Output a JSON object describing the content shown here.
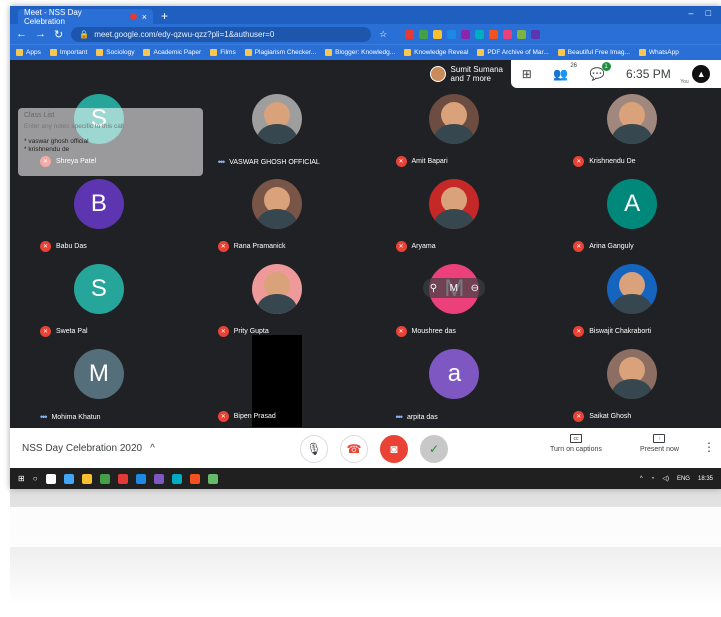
{
  "browser": {
    "tab_title": "Meet - NSS Day Celebration",
    "tab_close": "×",
    "new_tab": "+",
    "url": "meet.google.com/edy-qzwu-qzz?pli=1&authuser=0",
    "bookmarks": [
      "Apps",
      "Important",
      "Sociology",
      "Academic Paper",
      "Films",
      "Plagiarism Checker...",
      "Blogger: Knowledg...",
      "Knowledge Reveal",
      "PDF Archive of Mar...",
      "Beautiful Free Imag...",
      "WhatsApp"
    ],
    "extension_colors": [
      "#e53935",
      "#43a047",
      "#fbc02d",
      "#1e88e5",
      "#8e24aa",
      "#00acc1",
      "#f4511e",
      "#ec407a",
      "#7cb342",
      "#5e35b1"
    ]
  },
  "meet": {
    "presenter_chip": "Sumit Sumana",
    "presenter_chip_sub": "and 7 more",
    "chat_badge": "1",
    "people_count": "26",
    "clock": "6:35 PM",
    "you_label": "You",
    "meeting_title": "NSS Day Celebration 2020",
    "captions_label": "Turn on captions",
    "present_label": "Present now"
  },
  "class_list": {
    "title": "Class List",
    "note": "Enter any notes specific to this call",
    "entries": [
      "* vaswar ghosh official",
      "* krishnendu de"
    ]
  },
  "participants": [
    {
      "name": "Shreya Patel",
      "initial": "S",
      "color": "#26a69a",
      "type": "initial",
      "muted": true
    },
    {
      "name": "VASWAR GHOSH OFFICIAL",
      "initial": "",
      "color": "#9e9e9e",
      "type": "photo",
      "muted": false
    },
    {
      "name": "Amit Bapari",
      "initial": "",
      "color": "#6d4c41",
      "type": "photo",
      "muted": true
    },
    {
      "name": "Krishnendu De",
      "initial": "",
      "color": "#a1887f",
      "type": "photo",
      "muted": true
    },
    {
      "name": "Babu Das",
      "initial": "B",
      "color": "#5e35b1",
      "type": "initial",
      "muted": true
    },
    {
      "name": "Rana Pramanick",
      "initial": "",
      "color": "#795548",
      "type": "photo",
      "muted": true
    },
    {
      "name": "Aryama",
      "initial": "",
      "color": "#c62828",
      "type": "photo",
      "muted": true
    },
    {
      "name": "Arina Ganguly",
      "initial": "A",
      "color": "#00897b",
      "type": "initial",
      "muted": true
    },
    {
      "name": "Sweta Pal",
      "initial": "S",
      "color": "#26a69a",
      "type": "initial",
      "muted": true
    },
    {
      "name": "Prity Gupta",
      "initial": "",
      "color": "#ef9a9a",
      "type": "photo",
      "muted": true
    },
    {
      "name": "Moushree das",
      "initial": "M",
      "color": "#ec407a",
      "type": "initial",
      "muted": true
    },
    {
      "name": "Biswajit Chakraborti",
      "initial": "",
      "color": "#1565c0",
      "type": "photo",
      "muted": true
    },
    {
      "name": "Mohima Khatun",
      "initial": "M",
      "color": "#546e7a",
      "type": "initial",
      "muted": false
    },
    {
      "name": "Bipen Prasad",
      "initial": "",
      "color": "#000000",
      "type": "black",
      "muted": true
    },
    {
      "name": "arpita das",
      "initial": "a",
      "color": "#7e57c2",
      "type": "initial",
      "muted": false
    },
    {
      "name": "Saikat Ghosh",
      "initial": "",
      "color": "#8d6e63",
      "type": "photo",
      "muted": true
    }
  ],
  "taskbar": {
    "lang": "ENG",
    "time": "18:35",
    "app_colors": [
      "#ffffff",
      "#42a5f5",
      "#fbc02d",
      "#43a047",
      "#e53935",
      "#1e88e5",
      "#7e57c2",
      "#00acc1",
      "#f4511e",
      "#66bb6a"
    ]
  }
}
